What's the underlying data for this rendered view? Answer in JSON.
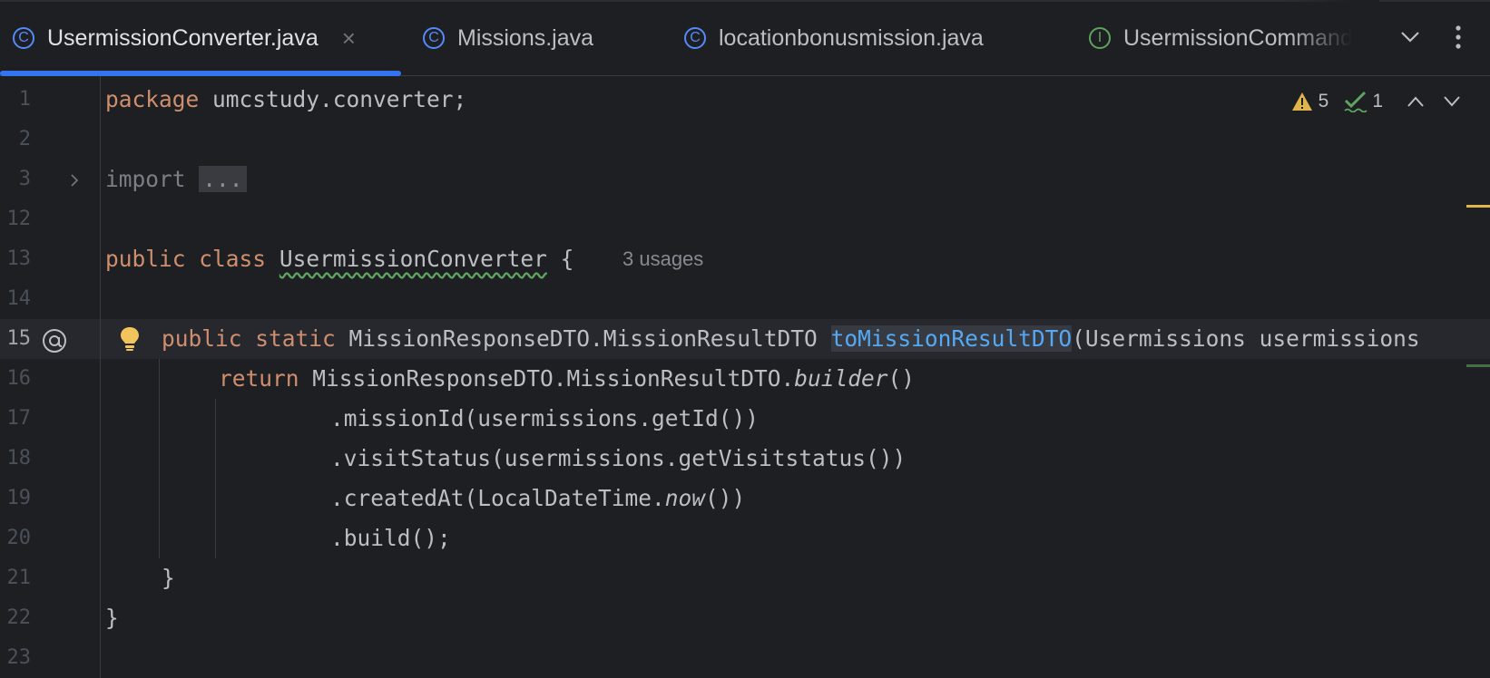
{
  "tabs": [
    {
      "label": "UsermissionConverter.java",
      "icon": "class-icon",
      "active": true,
      "close": "×"
    },
    {
      "label": "Missions.java",
      "icon": "class-icon",
      "active": false
    },
    {
      "label": "locationbonusmission.java",
      "icon": "class-icon",
      "active": false
    },
    {
      "label": "UsermissionCommand",
      "icon": "interface-icon",
      "active": false
    }
  ],
  "tab_icons": {
    "class": "C",
    "interface": "I"
  },
  "inspections": {
    "warnings": "5",
    "typos": "1"
  },
  "editor": {
    "line_numbers": [
      "1",
      "2",
      "3",
      "12",
      "13",
      "14",
      "15",
      "16",
      "17",
      "18",
      "19",
      "20",
      "21",
      "22",
      "23"
    ],
    "current_line": "15",
    "usages_hint": "3 usages",
    "code": {
      "l1_kw": "package",
      "l1_rest": " umcstudy.converter;",
      "l3_kw": "import",
      "l3_folded": "...",
      "l13_kw1": "public",
      "l13_kw2": "class",
      "l13_name": "UsermissionConverter",
      "l13_brace": " {",
      "l15_kw1": "public",
      "l15_kw2": "static",
      "l15_type": " MissionResponseDTO.MissionResultDTO ",
      "l15_method": "toMissionResultDTO",
      "l15_params": "(Usermissions usermissions",
      "l16_kw": "return",
      "l16_rest1": " MissionResponseDTO.MissionResultDTO.",
      "l16_builder": "builder",
      "l16_rest2": "()",
      "l17": ".missionId(usermissions.getId())",
      "l18": ".visitStatus(usermissions.getVisitstatus())",
      "l19_a": ".createdAt(LocalDateTime.",
      "l19_now": "now",
      "l19_b": "())",
      "l20": ".build();",
      "l21": "}",
      "l22": "}"
    }
  },
  "colors": {
    "accent": "#3574f0",
    "keyword": "#cf8e6d",
    "method": "#56a8f5",
    "warning": "#e0b44c",
    "typo": "#5fa360"
  }
}
